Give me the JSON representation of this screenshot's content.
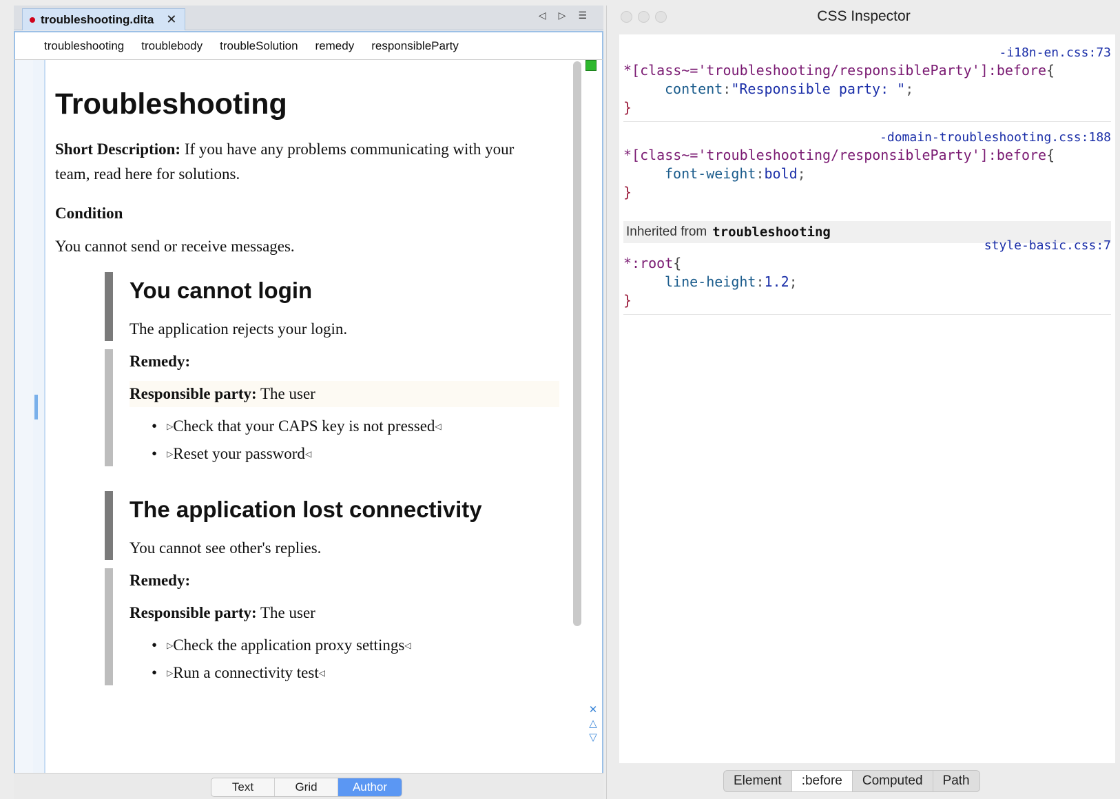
{
  "editor": {
    "tab_title": "troubleshooting.dita",
    "tab_close": "✕",
    "breadcrumb": [
      "troubleshooting",
      "troublebody",
      "troubleSolution",
      "remedy",
      "responsibleParty"
    ],
    "document": {
      "title": "Troubleshooting",
      "short_desc_label": "Short Description:",
      "short_desc_text": " If you have any problems communicating with your team, read here for solutions.",
      "condition_label": "Condition",
      "condition_text": "You cannot send or receive messages.",
      "solutions": [
        {
          "cause_title": "You cannot login",
          "cause_text": "The application rejects your login.",
          "remedy_label": "Remedy:",
          "responsible_label": "Responsible party:",
          "responsible_value": " The user",
          "steps": [
            "Check that your CAPS key is not pressed",
            "Reset your password"
          ]
        },
        {
          "cause_title": "The application lost connectivity",
          "cause_text": "You cannot see other's replies.",
          "remedy_label": "Remedy:",
          "responsible_label": "Responsible party:",
          "responsible_value": " The user",
          "steps": [
            "Check the application proxy settings",
            "Run a connectivity test"
          ]
        }
      ]
    },
    "modes": [
      "Text",
      "Grid",
      "Author"
    ],
    "active_mode": "Author",
    "bullet": "•",
    "tri_right": "▷",
    "tri_left": "◁"
  },
  "inspector": {
    "title": "CSS Inspector",
    "rules": [
      {
        "source": "-i18n-en.css:73",
        "selector": "*[class~='troubleshooting/responsibleParty']:before",
        "property": "content",
        "value": "\"Responsible party: \""
      },
      {
        "source": "-domain-troubleshooting.css:188",
        "selector": "*[class~='troubleshooting/responsibleParty']:before",
        "property": "font-weight",
        "value": "bold"
      },
      {
        "source": "style-basic.css:7",
        "selector": "*:root",
        "property": "line-height",
        "value": "1.2"
      }
    ],
    "inherited_label": "Inherited from",
    "inherited_element": "troubleshooting",
    "open_brace": "{",
    "close_brace": "}",
    "colon": ":",
    "semicolon": ";",
    "tabs": [
      "Element",
      ":before",
      "Computed",
      "Path"
    ],
    "active_tab": ":before"
  }
}
